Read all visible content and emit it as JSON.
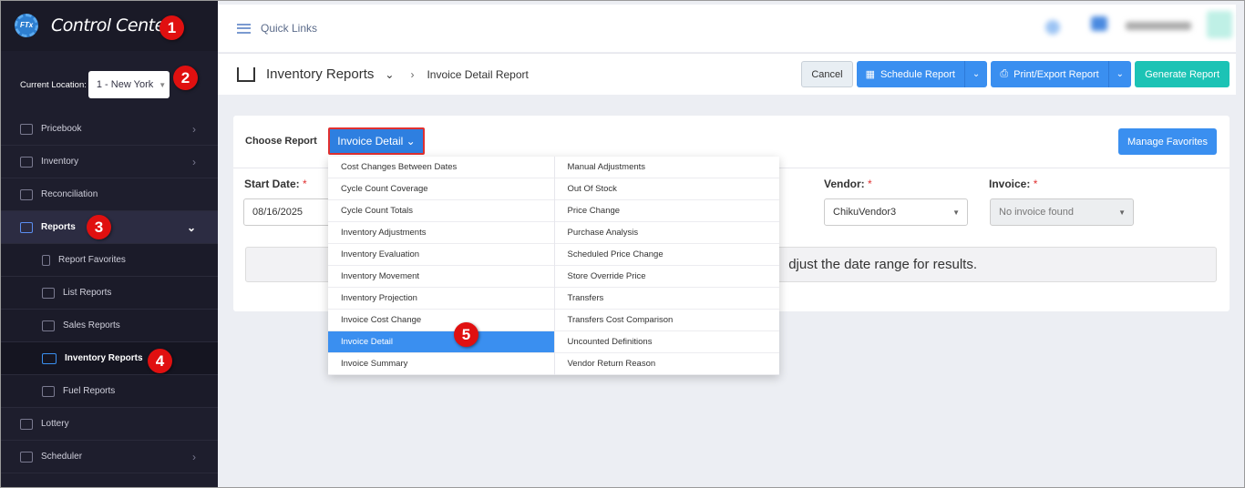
{
  "sidebar": {
    "logo": "Control Center",
    "location_label": "Current Location:",
    "location_value": "1 - New York",
    "items": [
      {
        "label": "Pricebook",
        "chevron": true
      },
      {
        "label": "Inventory",
        "chevron": true
      },
      {
        "label": "Reconciliation"
      },
      {
        "label": "Reports",
        "expanded": true
      },
      {
        "label": "Report Favorites"
      },
      {
        "label": "List Reports"
      },
      {
        "label": "Sales Reports"
      },
      {
        "label": "Inventory Reports"
      },
      {
        "label": "Fuel Reports"
      },
      {
        "label": "Lottery"
      },
      {
        "label": "Scheduler",
        "chevron": true
      }
    ]
  },
  "topbar": {
    "quick_links": "Quick Links"
  },
  "header": {
    "title": "Inventory Reports",
    "breadcrumb": "Invoice Detail Report",
    "cancel": "Cancel",
    "schedule": "Schedule Report",
    "print": "Print/Export Report",
    "generate": "Generate Report"
  },
  "card": {
    "choose_label": "Choose Report",
    "selected_report": "Invoice Detail",
    "manage_favorites": "Manage Favorites",
    "start_date_label": "Start Date:",
    "start_date": "08/16/2025",
    "vendor_label": "Vendor:",
    "vendor": "ChikuVendor3",
    "invoice_label": "Invoice:",
    "invoice": "No invoice found",
    "notice": "djust the date range for results.",
    "required": "*"
  },
  "menu": {
    "col1": [
      "Cost Changes Between Dates",
      "Cycle Count Coverage",
      "Cycle Count Totals",
      "Inventory Adjustments",
      "Inventory Evaluation",
      "Inventory Movement",
      "Inventory Projection",
      "Invoice Cost Change",
      "Invoice Detail",
      "Invoice Summary"
    ],
    "col2": [
      "Manual Adjustments",
      "Out Of Stock",
      "Price Change",
      "Purchase Analysis",
      "Scheduled Price Change",
      "Store Override Price",
      "Transfers",
      "Transfers Cost Comparison",
      "Uncounted Definitions",
      "Vendor Return Reason"
    ],
    "selected": "Invoice Detail"
  },
  "annotations": [
    "1",
    "2",
    "3",
    "4",
    "5"
  ],
  "colors": {
    "accent": "#3a8ff0",
    "teal": "#1cc3b5",
    "sidebar": "#1e1e2d",
    "marker": "#e01010"
  }
}
